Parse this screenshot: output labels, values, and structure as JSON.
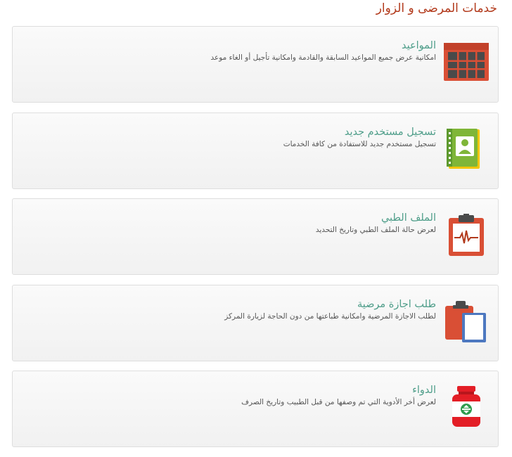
{
  "page": {
    "title": "خدمات المرضى و الزوار"
  },
  "services": [
    {
      "title": "المواعيد",
      "description": "امكانية عرض جميع المواعيد السابقة والقادمة وامكانية تأجيل أو الغاء موعد",
      "icon": "calendar-table-icon"
    },
    {
      "title": "تسجيل مستخدم جديد",
      "description": "تسجيل مستخدم جديد للاستفادة من كافة الخدمات",
      "icon": "address-book-icon"
    },
    {
      "title": "الملف الطبي",
      "description": "لعرض حالة الملف الطبي وتاريخ التحديد",
      "icon": "medical-clipboard-icon"
    },
    {
      "title": "طلب اجازة مرضية",
      "description": "لطلب الاجازة المرضية وامكانية طباعتها من دون الحاجة لزيارة المركز",
      "icon": "clipboard-paper-icon"
    },
    {
      "title": "الدواء",
      "description": "لعرض أخر الأدوية التي تم وصفها من قبل الطبيب وتاريخ الصرف",
      "icon": "medicine-bottle-icon"
    }
  ],
  "colors": {
    "title": "#b23a1c",
    "service_title": "#4f9e8a",
    "icon_red": "#d94f35",
    "icon_green": "#7fb638",
    "icon_dark": "#4a4a4a",
    "icon_blue": "#4d78c0",
    "bottle_red": "#e31e26"
  }
}
